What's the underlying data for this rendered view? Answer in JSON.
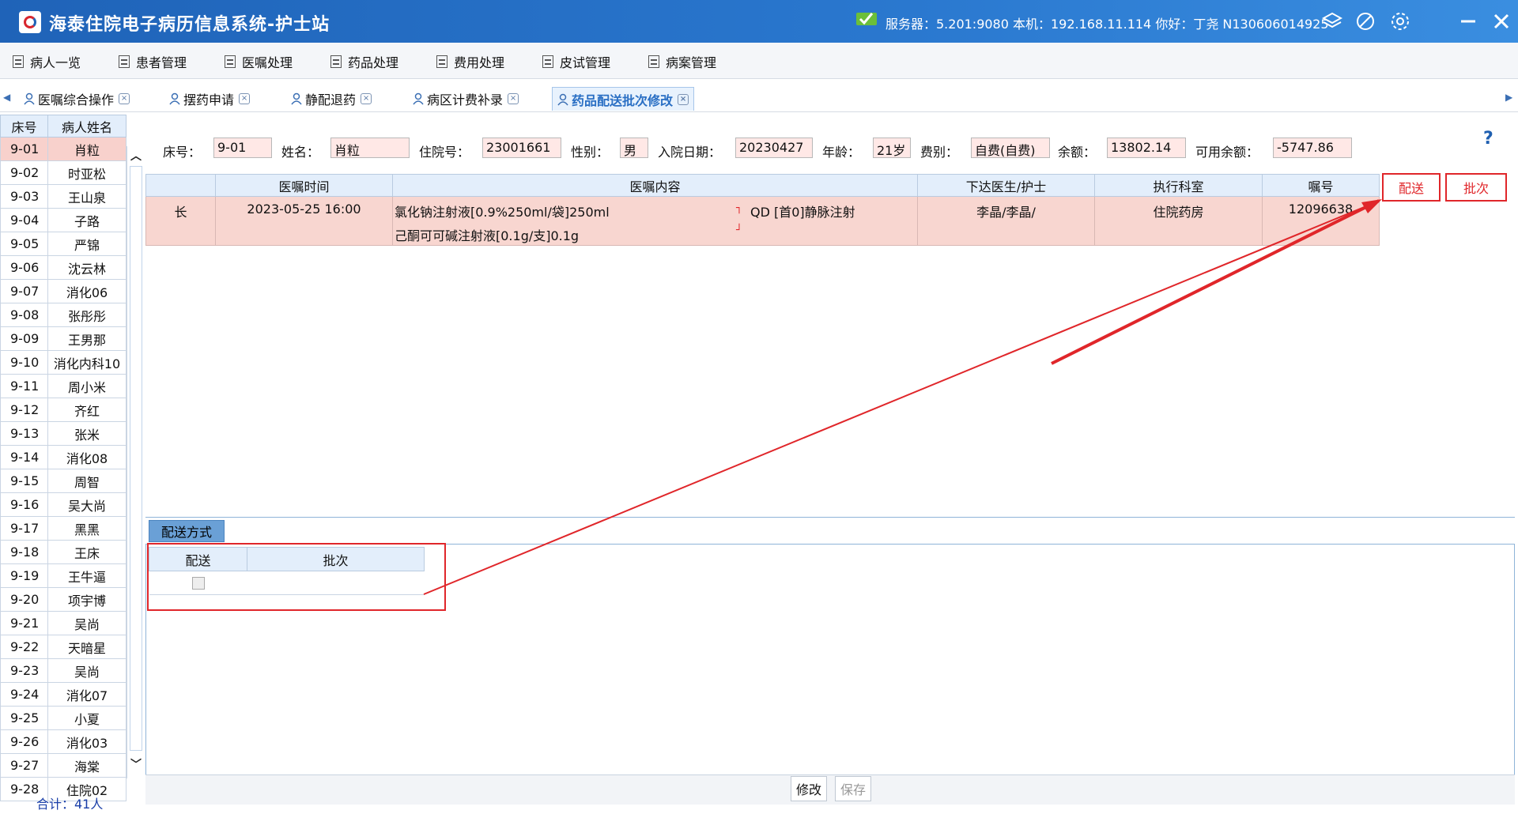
{
  "window": {
    "title": "海泰住院电子病历信息系统-护士站",
    "status": "服务器：5.201:9080 本机：192.168.11.114 你好：丁尧 N130606014925"
  },
  "menu": [
    "病人一览",
    "患者管理",
    "医嘱处理",
    "药品处理",
    "费用处理",
    "皮试管理",
    "病案管理"
  ],
  "tabs": [
    "医嘱综合操作",
    "摆药申请",
    "静配退药",
    "病区计费补录",
    "药品配送批次修改"
  ],
  "patient_list": {
    "headers": [
      "床号",
      "病人姓名"
    ],
    "rows": [
      [
        "9-01",
        "肖粒"
      ],
      [
        "9-02",
        "时亚松"
      ],
      [
        "9-03",
        "王山泉"
      ],
      [
        "9-04",
        "子路"
      ],
      [
        "9-05",
        "严锦"
      ],
      [
        "9-06",
        "沈云林"
      ],
      [
        "9-07",
        "消化06"
      ],
      [
        "9-08",
        "张彤彤"
      ],
      [
        "9-09",
        "王男那"
      ],
      [
        "9-10",
        "消化内科10"
      ],
      [
        "9-11",
        "周小米"
      ],
      [
        "9-12",
        "齐红"
      ],
      [
        "9-13",
        "张米"
      ],
      [
        "9-14",
        "消化08"
      ],
      [
        "9-15",
        "周智"
      ],
      [
        "9-16",
        "吴大尚"
      ],
      [
        "9-17",
        "黑黑"
      ],
      [
        "9-18",
        "王床"
      ],
      [
        "9-19",
        "王牛逼"
      ],
      [
        "9-20",
        "项宇博"
      ],
      [
        "9-21",
        "吴尚"
      ],
      [
        "9-22",
        "天暗星"
      ],
      [
        "9-23",
        "吴尚"
      ],
      [
        "9-24",
        "消化07"
      ],
      [
        "9-25",
        "小夏"
      ],
      [
        "9-26",
        "消化03"
      ],
      [
        "9-27",
        "海棠"
      ],
      [
        "9-28",
        "住院02"
      ]
    ],
    "total": "合计：41人"
  },
  "patient_info": {
    "bed_label": "床号：",
    "bed": "9-01",
    "name_label": "姓名：",
    "name": "肖粒",
    "admission_no_label": "住院号：",
    "admission_no": "23001661",
    "gender_label": "性别：",
    "gender": "男",
    "admit_date_label": "入院日期：",
    "admit_date": "20230427",
    "age_label": "年龄：",
    "age": "21岁",
    "fee_type_label": "费别：",
    "fee_type": "自费(自费)",
    "balance_label": "余额：",
    "balance": "13802.14",
    "available_label": "可用余额：",
    "available": "-5747.86"
  },
  "orders": {
    "headers": [
      "",
      "医嘱时间",
      "医嘱内容",
      "下达医生/护士",
      "执行科室",
      "嘱号"
    ],
    "rows": [
      {
        "type": "长",
        "time": "2023-05-25 16:00",
        "content_line1": "氯化钠注射液[0.9%250ml/袋]250ml",
        "content_line2": "己酮可可碱注射液[0.1g/支]0.1g",
        "freq": "QD [首0]静脉注射",
        "doctor": "李晶/李晶/",
        "dept": "住院药房",
        "order_no": "12096638"
      }
    ]
  },
  "annotations": {
    "distribution": "配送",
    "batch": "批次"
  },
  "bottom_panel": {
    "tab": "配送方式",
    "headers": [
      "配送",
      "批次"
    ],
    "modify_button": "修改",
    "save_button": "保存"
  }
}
